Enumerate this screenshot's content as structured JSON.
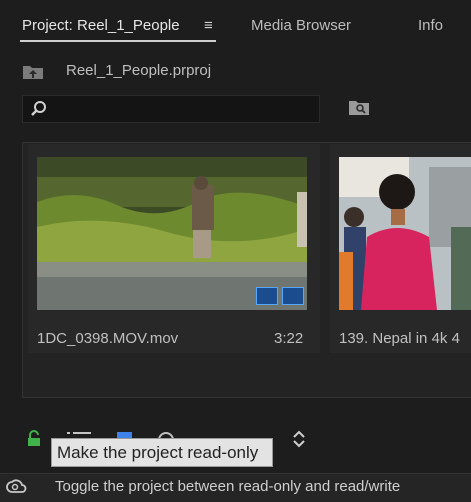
{
  "tabs": [
    {
      "label": "Project: Reel_1_People",
      "active": true
    },
    {
      "label": "Media Browser",
      "active": false
    },
    {
      "label": "Info",
      "active": false
    }
  ],
  "project": {
    "file_name": "Reel_1_People.prproj"
  },
  "search": {
    "value": "",
    "placeholder": ""
  },
  "clips": [
    {
      "name": "1DC_0398.MOV.mov",
      "duration": "3:22"
    },
    {
      "name": "139. Nepal in 4k 4",
      "duration": ""
    }
  ],
  "toolbar": {
    "tooltip": "Make the project read-only",
    "icons": [
      "lock-icon",
      "list-view-icon",
      "icon-view-icon",
      "freeform-view-icon",
      "sort-icon"
    ]
  },
  "status_bar": {
    "text": "Toggle the project between read-only and read/write"
  },
  "colors": {
    "accent_blue": "#3d82e8",
    "lock_green": "#3fb24a",
    "background": "#1d1d1d"
  }
}
